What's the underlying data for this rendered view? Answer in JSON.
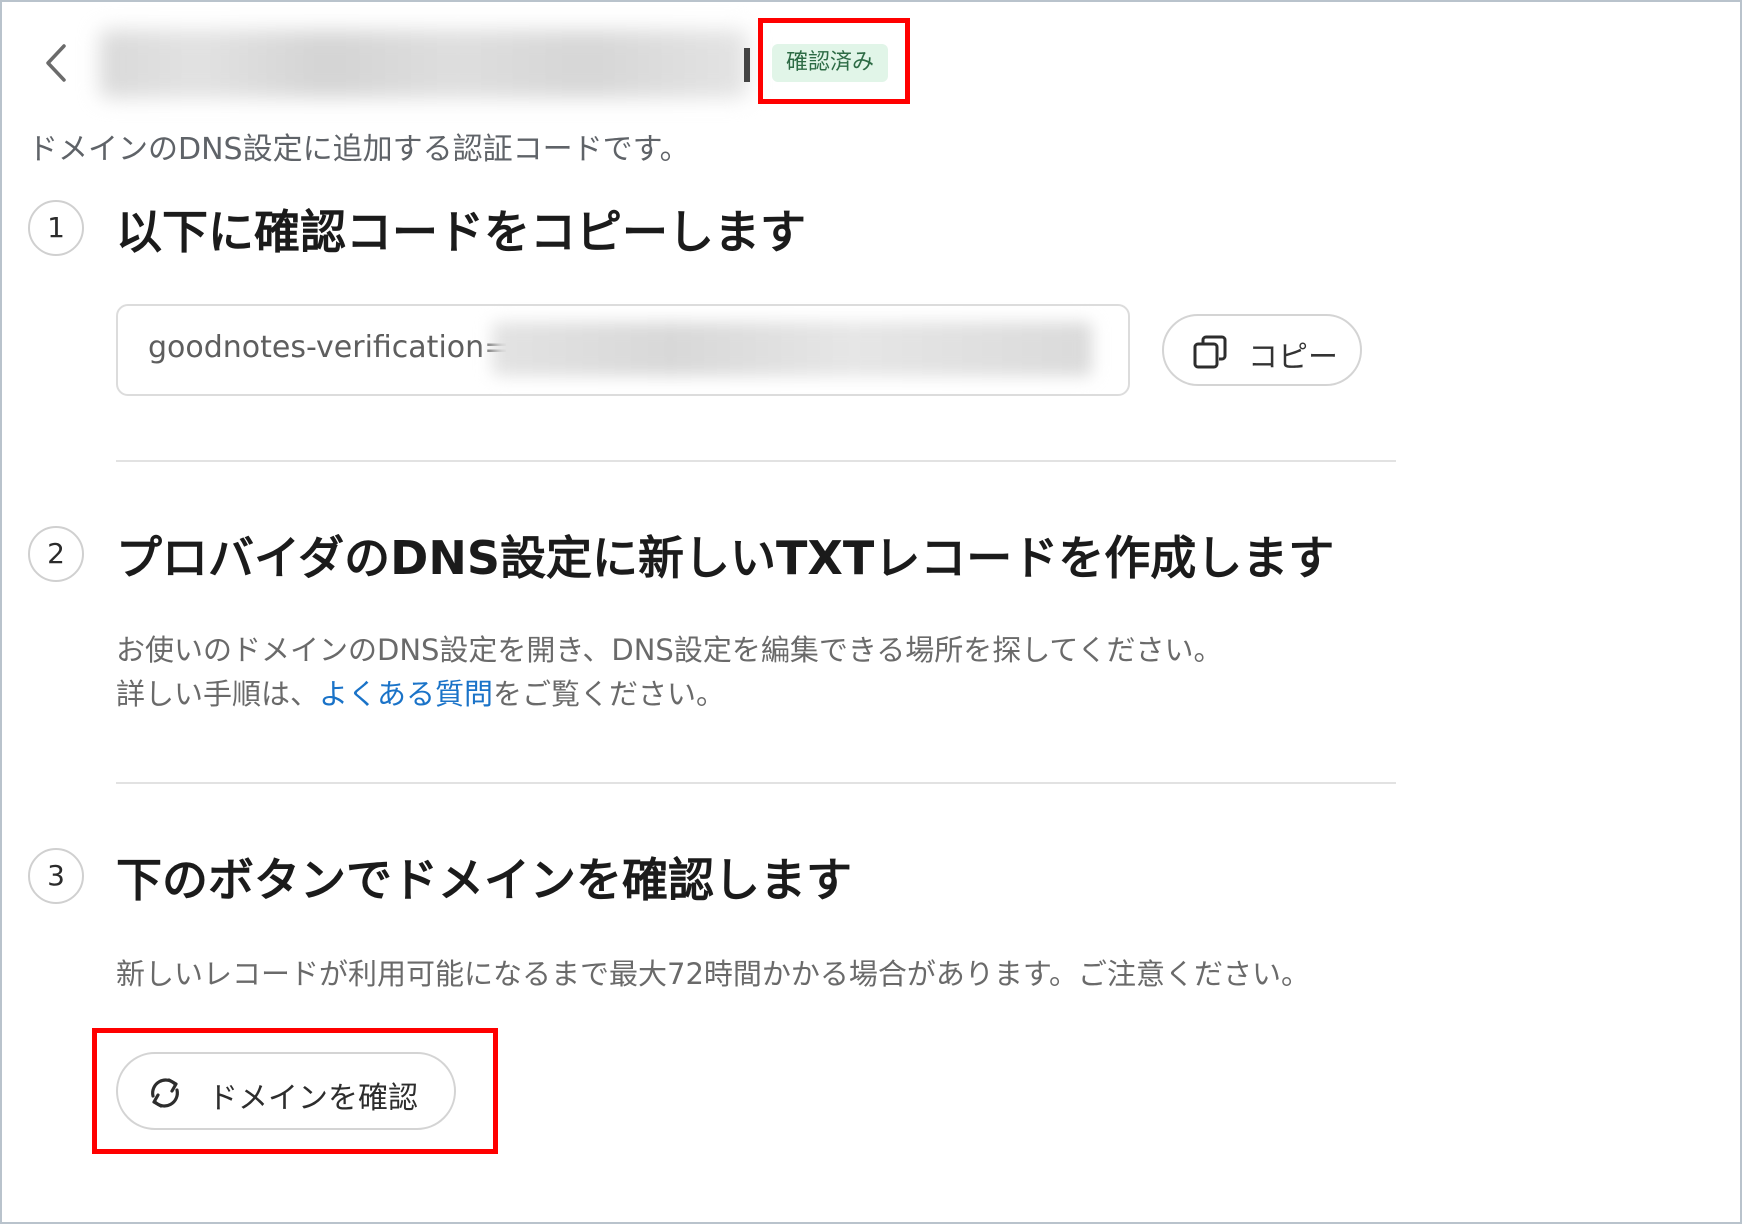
{
  "header": {
    "back_icon": "chevron-left-icon",
    "status_badge": "確認済み",
    "colors": {
      "badge_bg": "#e1f5e8",
      "badge_text": "#2d6b45",
      "highlight": "#ff0000",
      "link": "#1a73c8"
    }
  },
  "intro": "ドメインのDNS設定に追加する認証コードです。",
  "steps": [
    {
      "number": "1",
      "title": "以下に確認コードをコピーします",
      "code_prefix": "goodnotes-verification=",
      "copy_button": {
        "icon": "copy-icon",
        "label": "コピー"
      }
    },
    {
      "number": "2",
      "title": "プロバイダのDNS設定に新しいTXTレコードを作成します",
      "desc_line1": "お使いのドメインのDNS設定を開き、DNS設定を編集できる場所を探してください。",
      "desc_line2_before": "詳しい手順は、",
      "desc_line2_link": "よくある質問",
      "desc_line2_after": "をご覧ください。"
    },
    {
      "number": "3",
      "title": "下のボタンでドメインを確認します",
      "desc": "新しいレコードが利用可能になるまで最大72時間かかる場合があります。ご注意ください。",
      "verify_button": {
        "icon": "refresh-icon",
        "label": "ドメインを確認"
      }
    }
  ]
}
